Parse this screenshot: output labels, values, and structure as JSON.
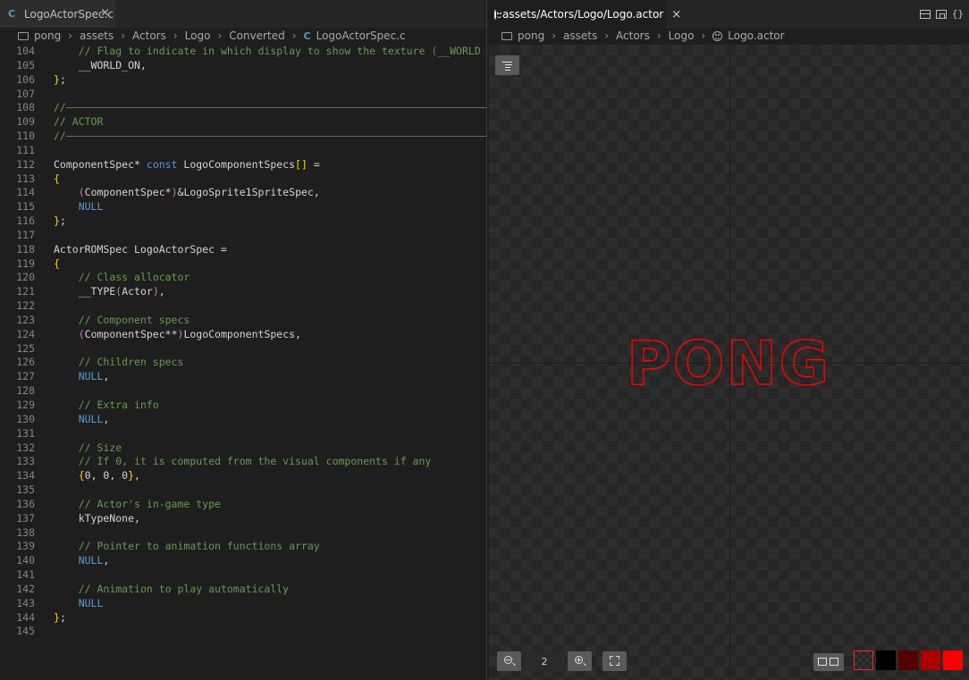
{
  "left": {
    "tab": {
      "icon": "C",
      "label": "LogoActorSpec.c",
      "close": "×"
    },
    "breadcrumb": [
      "pong",
      "assets",
      "Actors",
      "Logo",
      "Converted"
    ],
    "breadcrumb_file": "LogoActorSpec.c",
    "lines": [
      {
        "n": "104",
        "t": "    // Flag to indicate in which display to show the texture (__WORLD"
      },
      {
        "n": "105",
        "t": "    __WORLD_ON,"
      },
      {
        "n": "106",
        "t": "};"
      },
      {
        "n": "107",
        "t": ""
      },
      {
        "n": "108",
        "t": "//"
      },
      {
        "n": "109",
        "t": "// ACTOR"
      },
      {
        "n": "110",
        "t": "//"
      },
      {
        "n": "111",
        "t": ""
      },
      {
        "n": "112",
        "t": "ComponentSpec* const LogoComponentSpecs[] ="
      },
      {
        "n": "113",
        "t": "{"
      },
      {
        "n": "114",
        "t": "    (ComponentSpec*)&LogoSprite1SpriteSpec,"
      },
      {
        "n": "115",
        "t": "    NULL"
      },
      {
        "n": "116",
        "t": "};"
      },
      {
        "n": "117",
        "t": ""
      },
      {
        "n": "118",
        "t": "ActorROMSpec LogoActorSpec ="
      },
      {
        "n": "119",
        "t": "{"
      },
      {
        "n": "120",
        "t": "    // Class allocator"
      },
      {
        "n": "121",
        "t": "    __TYPE(Actor),"
      },
      {
        "n": "122",
        "t": ""
      },
      {
        "n": "123",
        "t": "    // Component specs"
      },
      {
        "n": "124",
        "t": "    (ComponentSpec**)LogoComponentSpecs,"
      },
      {
        "n": "125",
        "t": ""
      },
      {
        "n": "126",
        "t": "    // Children specs"
      },
      {
        "n": "127",
        "t": "    NULL,"
      },
      {
        "n": "128",
        "t": ""
      },
      {
        "n": "129",
        "t": "    // Extra info"
      },
      {
        "n": "130",
        "t": "    NULL,"
      },
      {
        "n": "131",
        "t": ""
      },
      {
        "n": "132",
        "t": "    // Size"
      },
      {
        "n": "133",
        "t": "    // If 0, it is computed from the visual components if any"
      },
      {
        "n": "134",
        "t": "    {0, 0, 0},"
      },
      {
        "n": "135",
        "t": ""
      },
      {
        "n": "136",
        "t": "    // Actor's in-game type"
      },
      {
        "n": "137",
        "t": "    kTypeNone,"
      },
      {
        "n": "138",
        "t": ""
      },
      {
        "n": "139",
        "t": "    // Pointer to animation functions array"
      },
      {
        "n": "140",
        "t": "    NULL,"
      },
      {
        "n": "141",
        "t": ""
      },
      {
        "n": "142",
        "t": "    // Animation to play automatically"
      },
      {
        "n": "143",
        "t": "    NULL"
      },
      {
        "n": "144",
        "t": "};"
      },
      {
        "n": "145",
        "t": ""
      }
    ]
  },
  "right": {
    "tab": {
      "icon": "smiley-icon",
      "label": "assets/Actors/Logo/Logo.actor",
      "close": "×"
    },
    "tab_actions": [
      "split-editor-icon",
      "preview-icon",
      "json-braces-icon"
    ],
    "braces": "{}",
    "breadcrumb": [
      "pong",
      "assets",
      "Actors",
      "Logo"
    ],
    "breadcrumb_file": "Logo.actor",
    "sprite_text": "PONG",
    "sprite_color": "#ff0000",
    "zoom": "2",
    "palette": [
      "transparent",
      "#000000",
      "#550000",
      "#aa0000",
      "#ff0000"
    ],
    "palette_selected": 0
  }
}
